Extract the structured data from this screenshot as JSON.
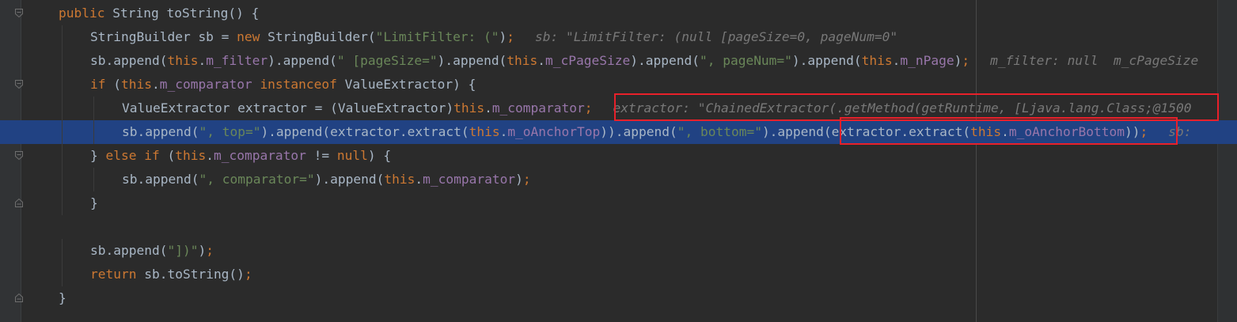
{
  "editor": {
    "language": "Java",
    "lines": [
      {
        "indent": 0,
        "current": false,
        "tokens": [
          {
            "t": "public",
            "c": "kw"
          },
          {
            "t": " String toString() {"
          }
        ]
      },
      {
        "indent": 1,
        "current": false,
        "tokens": [
          {
            "t": "StringBuilder sb = "
          },
          {
            "t": "new",
            "c": "kw"
          },
          {
            "t": " StringBuilder("
          },
          {
            "t": "\"LimitFilter: (\"",
            "c": "str"
          },
          {
            "t": ")"
          },
          {
            "t": ";",
            "c": "kw"
          }
        ],
        "hint": "sb: \"LimitFilter: (null [pageSize=0, pageNum=0\""
      },
      {
        "indent": 1,
        "current": false,
        "tokens": [
          {
            "t": "sb.append("
          },
          {
            "t": "this",
            "c": "kw"
          },
          {
            "t": "."
          },
          {
            "t": "m_filter",
            "c": "fld"
          },
          {
            "t": ").append("
          },
          {
            "t": "\" [pageSize=\"",
            "c": "str"
          },
          {
            "t": ").append("
          },
          {
            "t": "this",
            "c": "kw"
          },
          {
            "t": "."
          },
          {
            "t": "m_cPageSize",
            "c": "fld"
          },
          {
            "t": ").append("
          },
          {
            "t": "\", pageNum=\"",
            "c": "str"
          },
          {
            "t": ").append("
          },
          {
            "t": "this",
            "c": "kw"
          },
          {
            "t": "."
          },
          {
            "t": "m_nPage",
            "c": "fld"
          },
          {
            "t": ")"
          },
          {
            "t": ";",
            "c": "kw"
          }
        ],
        "hint": "m_filter: null  m_cPageSize"
      },
      {
        "indent": 1,
        "current": false,
        "tokens": [
          {
            "t": "if",
            "c": "kw"
          },
          {
            "t": " ("
          },
          {
            "t": "this",
            "c": "kw"
          },
          {
            "t": "."
          },
          {
            "t": "m_comparator",
            "c": "fld"
          },
          {
            "t": " "
          },
          {
            "t": "instanceof",
            "c": "kw"
          },
          {
            "t": " ValueExtractor) {"
          }
        ]
      },
      {
        "indent": 2,
        "current": false,
        "tokens": [
          {
            "t": "ValueExtractor extractor = (ValueExtractor)"
          },
          {
            "t": "this",
            "c": "kw"
          },
          {
            "t": "."
          },
          {
            "t": "m_comparator",
            "c": "fld"
          },
          {
            "t": ";",
            "c": "kw"
          }
        ],
        "hint": "extractor: \"ChainedExtractor(.getMethod(getRuntime, [Ljava.lang.Class;@1500"
      },
      {
        "indent": 2,
        "current": true,
        "tokens": [
          {
            "t": "sb.append("
          },
          {
            "t": "\", top=\"",
            "c": "str"
          },
          {
            "t": ").append(extractor.extract("
          },
          {
            "t": "this",
            "c": "kw"
          },
          {
            "t": "."
          },
          {
            "t": "m_oAnchorTop",
            "c": "fld"
          },
          {
            "t": ")).append("
          },
          {
            "t": "\", bottom=\"",
            "c": "str"
          },
          {
            "t": ").append("
          },
          {
            "t": "extractor.extract("
          },
          {
            "t": "this",
            "c": "kw"
          },
          {
            "t": "."
          },
          {
            "t": "m_oAnchorBottom",
            "c": "fld"
          },
          {
            "t": "))"
          },
          {
            "t": ";",
            "c": "kw"
          }
        ],
        "hint": "sb:"
      },
      {
        "indent": 1,
        "current": false,
        "tokens": [
          {
            "t": "} "
          },
          {
            "t": "else if",
            "c": "kw"
          },
          {
            "t": " ("
          },
          {
            "t": "this",
            "c": "kw"
          },
          {
            "t": "."
          },
          {
            "t": "m_comparator",
            "c": "fld"
          },
          {
            "t": " != "
          },
          {
            "t": "null",
            "c": "kw"
          },
          {
            "t": ") {"
          }
        ]
      },
      {
        "indent": 2,
        "current": false,
        "tokens": [
          {
            "t": "sb.append("
          },
          {
            "t": "\", comparator=\"",
            "c": "str"
          },
          {
            "t": ").append("
          },
          {
            "t": "this",
            "c": "kw"
          },
          {
            "t": "."
          },
          {
            "t": "m_comparator",
            "c": "fld"
          },
          {
            "t": ")"
          },
          {
            "t": ";",
            "c": "kw"
          }
        ]
      },
      {
        "indent": 1,
        "current": false,
        "tokens": [
          {
            "t": "}"
          }
        ]
      },
      {
        "indent": 0,
        "current": false,
        "tokens": []
      },
      {
        "indent": 1,
        "current": false,
        "tokens": [
          {
            "t": "sb.append("
          },
          {
            "t": "\"])\"",
            "c": "str"
          },
          {
            "t": ")"
          },
          {
            "t": ";",
            "c": "kw"
          }
        ]
      },
      {
        "indent": 1,
        "current": false,
        "tokens": [
          {
            "t": "return",
            "c": "kw"
          },
          {
            "t": " sb.toString()"
          },
          {
            "t": ";",
            "c": "kw"
          }
        ]
      },
      {
        "indent": 0,
        "current": false,
        "tokens": [
          {
            "t": "}"
          }
        ]
      }
    ]
  },
  "gutter": {
    "fold_icons": [
      {
        "line": 0,
        "type": "fold-start-icon"
      },
      {
        "line": 3,
        "type": "fold-start-icon"
      },
      {
        "line": 6,
        "type": "fold-start-icon"
      },
      {
        "line": 8,
        "type": "fold-end-icon"
      },
      {
        "line": 12,
        "type": "fold-end-icon"
      }
    ]
  },
  "colors": {
    "background": "#2b2b2b",
    "keyword": "#cc7832",
    "string": "#6a8759",
    "field": "#9876aa",
    "text": "#a9b7c6",
    "hint": "#787878",
    "current_line": "#214283",
    "annotation_box": "#e8202a"
  }
}
